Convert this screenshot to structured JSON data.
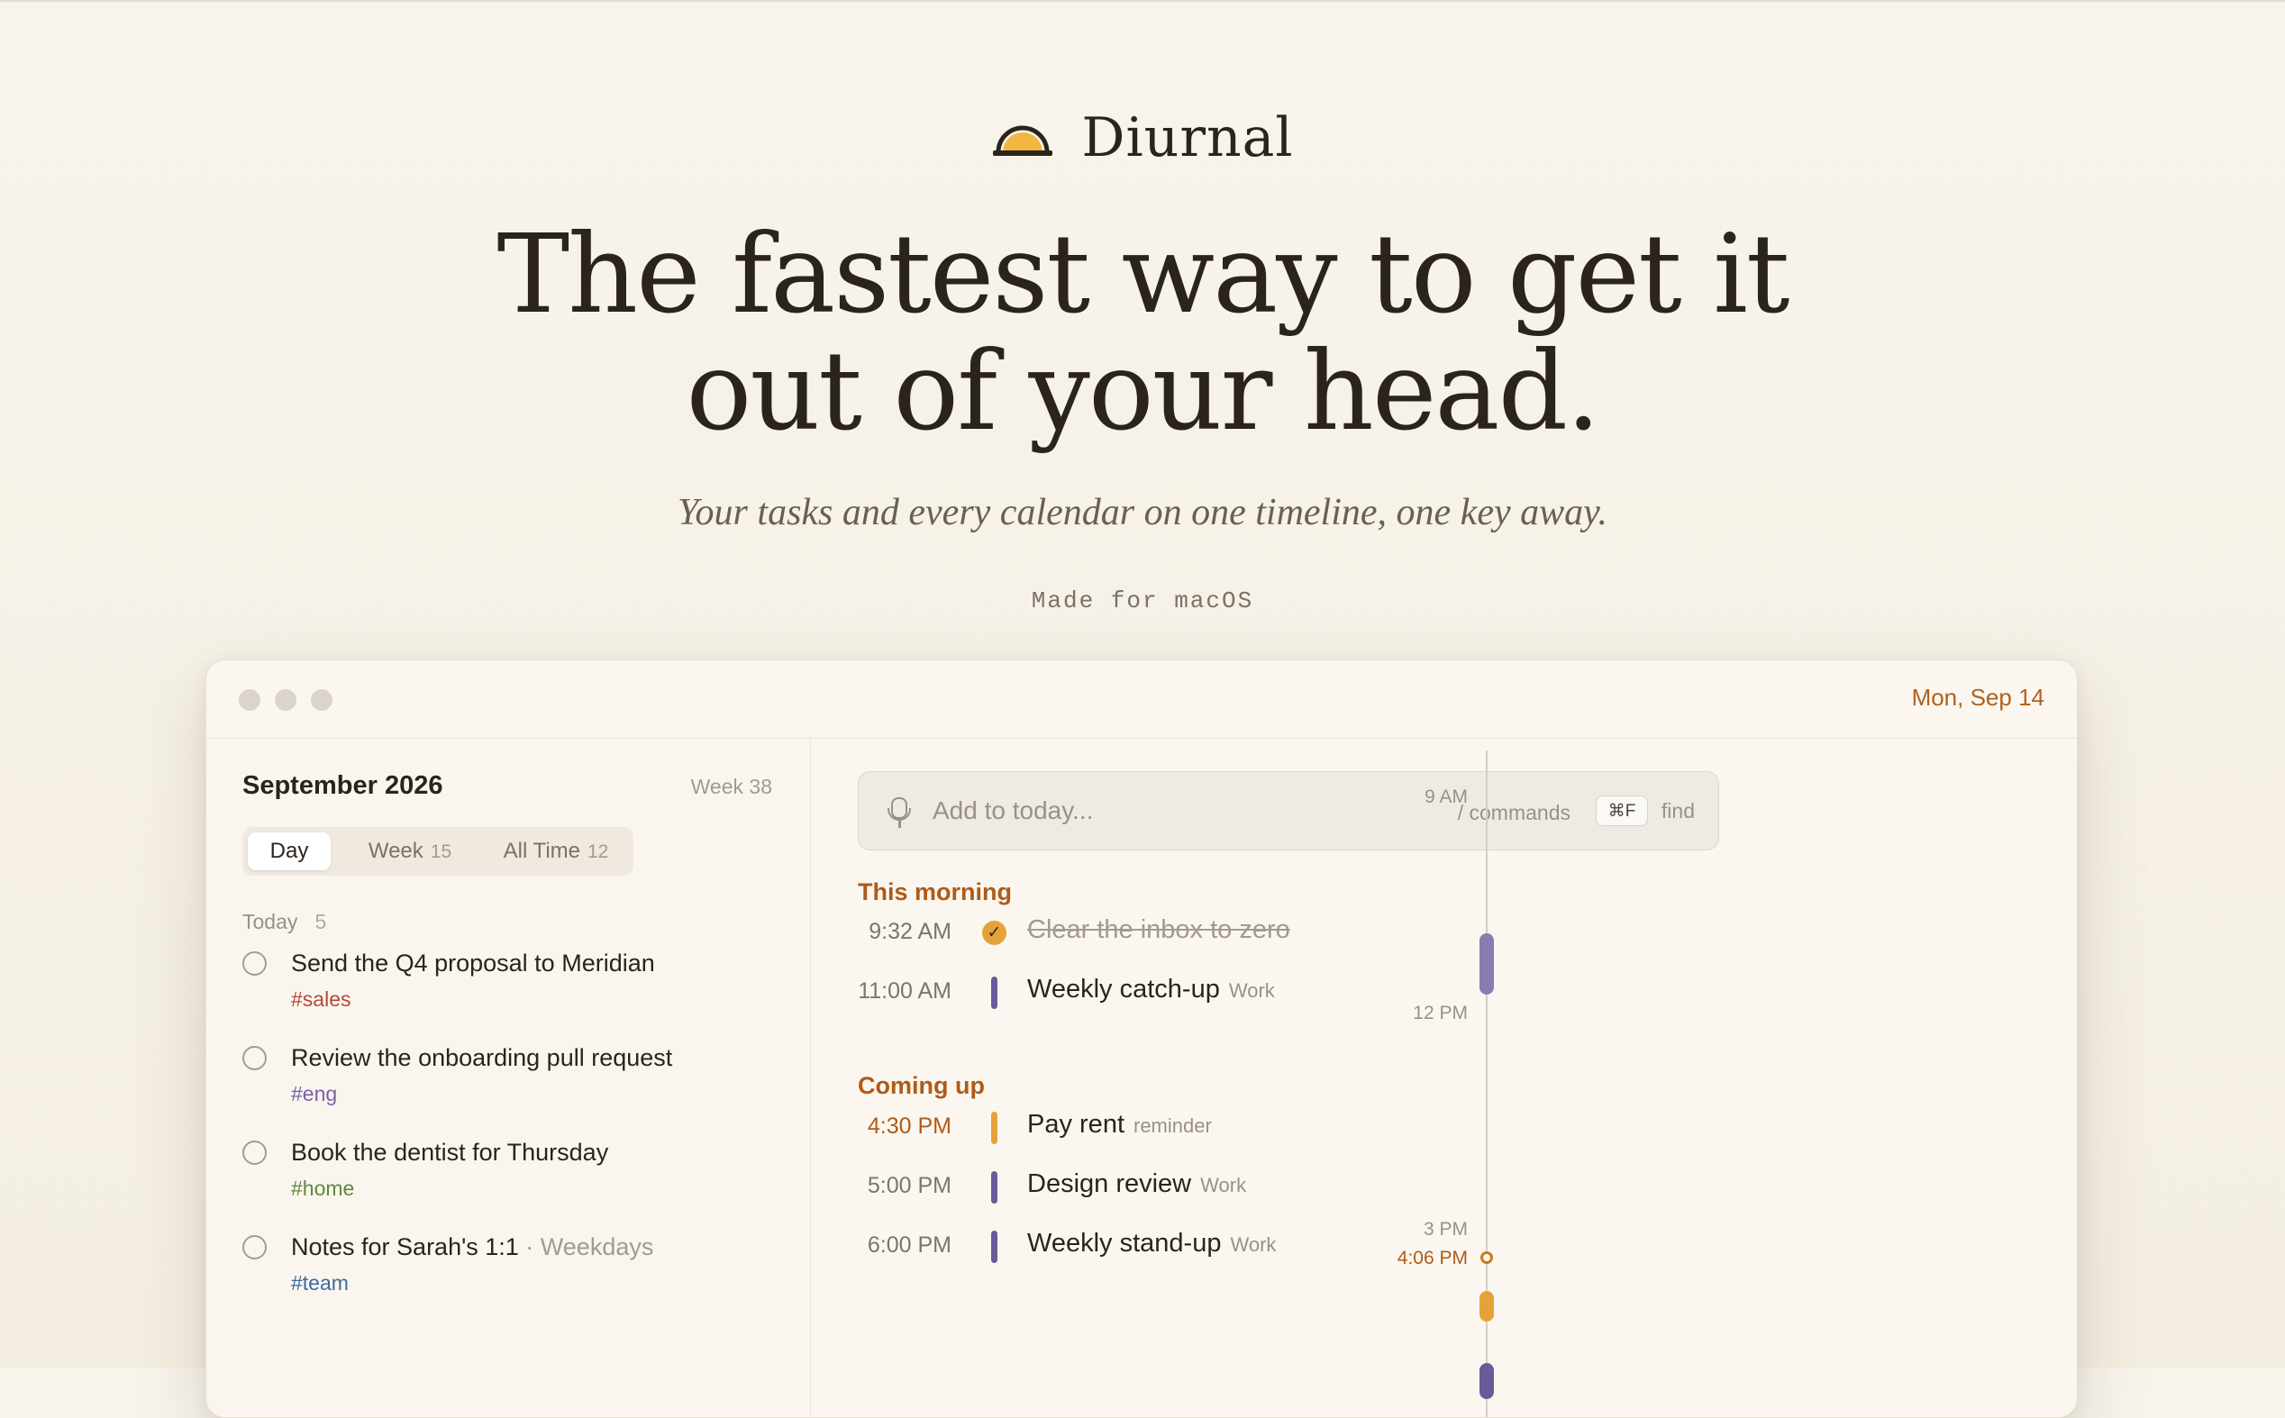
{
  "brand": {
    "name": "Diurnal",
    "logo_icon": "sunrise-icon"
  },
  "hero": {
    "headline_line1": "The fastest way to get it",
    "headline_line2": "out of your head.",
    "tagline": "Your tasks and every calendar on one timeline, one key away.",
    "platform_note": "Made for macOS"
  },
  "window": {
    "date": "Mon, Sep 14",
    "sidebar": {
      "month": "September 2026",
      "week": "Week 38",
      "tabs": [
        {
          "label": "Day",
          "count": ""
        },
        {
          "label": "Week",
          "count": "15"
        },
        {
          "label": "All Time",
          "count": "12"
        }
      ],
      "section_label": "Today",
      "section_count": "5",
      "tasks": [
        {
          "title": "Send the Q4 proposal to Meridian",
          "extra": "",
          "tag": "#sales",
          "tag_color": "#b5483a"
        },
        {
          "title": "Review the onboarding pull request",
          "extra": "",
          "tag": "#eng",
          "tag_color": "#7a5fa8"
        },
        {
          "title": "Book the dentist for Thursday",
          "extra": "",
          "tag": "#home",
          "tag_color": "#5f8a3e"
        },
        {
          "title": "Notes for Sarah's 1:1",
          "extra": " · Weekdays",
          "tag": "#team",
          "tag_color": "#3f6aa0"
        }
      ]
    },
    "main": {
      "add_placeholder": "Add to today...",
      "commands_hint": "/ commands",
      "find_shortcut": "⌘F",
      "find_label": "find",
      "sections": [
        {
          "title": "This morning",
          "events": [
            {
              "time": "9:32 AM",
              "title": "Clear the inbox to zero",
              "calendar": "",
              "done": true,
              "color": "#e5a23a"
            },
            {
              "time": "11:00 AM",
              "title": "Weekly catch-up",
              "calendar": "Work",
              "done": false,
              "color": "#6b5a9a"
            }
          ]
        },
        {
          "title": "Coming up",
          "events": [
            {
              "time": "4:30 PM",
              "title": "Pay rent",
              "calendar": "reminder",
              "done": false,
              "color": "#e5a23a",
              "time_color": "#b05a18"
            },
            {
              "time": "5:00 PM",
              "title": "Design review",
              "calendar": "Work",
              "done": false,
              "color": "#6b5a9a"
            },
            {
              "time": "6:00 PM",
              "title": "Weekly stand-up",
              "calendar": "Work",
              "done": false,
              "color": "#6b5a9a"
            }
          ]
        }
      ]
    },
    "timeline": {
      "hours": [
        "9 AM",
        "12 PM",
        "3 PM"
      ],
      "now_label": "4:06 PM"
    }
  }
}
